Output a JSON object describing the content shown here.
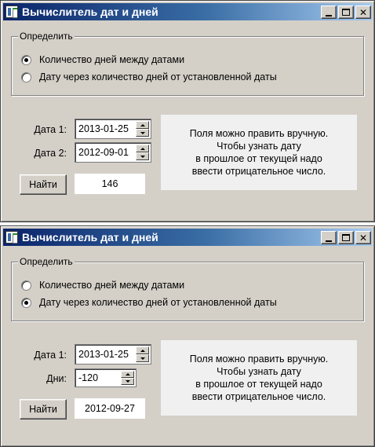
{
  "windows": [
    {
      "title": "Вычислитель дат и дней",
      "group": {
        "legend": "Определить",
        "options": [
          {
            "label": "Количество дней между датами",
            "checked": true
          },
          {
            "label": "Дату через количество дней от установленной даты",
            "checked": false
          }
        ]
      },
      "fields": [
        {
          "label": "Дата 1:",
          "value": "2013-01-25"
        },
        {
          "label": "Дата 2:",
          "value": "2012-09-01"
        }
      ],
      "button_label": "Найти",
      "result": "146",
      "info_lines": [
        "Поля можно править вручную.",
        "Чтобы узнать дату",
        "в прошлое от текущей надо",
        "ввести отрицательное число."
      ]
    },
    {
      "title": "Вычислитель дат и дней",
      "group": {
        "legend": "Определить",
        "options": [
          {
            "label": "Количество дней между датами",
            "checked": false
          },
          {
            "label": "Дату через количество дней от установленной даты",
            "checked": true
          }
        ]
      },
      "fields": [
        {
          "label": "Дата 1:",
          "value": "2013-01-25"
        },
        {
          "label": "Дни:",
          "value": "-120"
        }
      ],
      "button_label": "Найти",
      "result": "2012-09-27",
      "info_lines": [
        "Поля можно править вручную.",
        "Чтобы узнать дату",
        "в прошлое от текущей надо",
        "ввести отрицательное число."
      ]
    }
  ]
}
